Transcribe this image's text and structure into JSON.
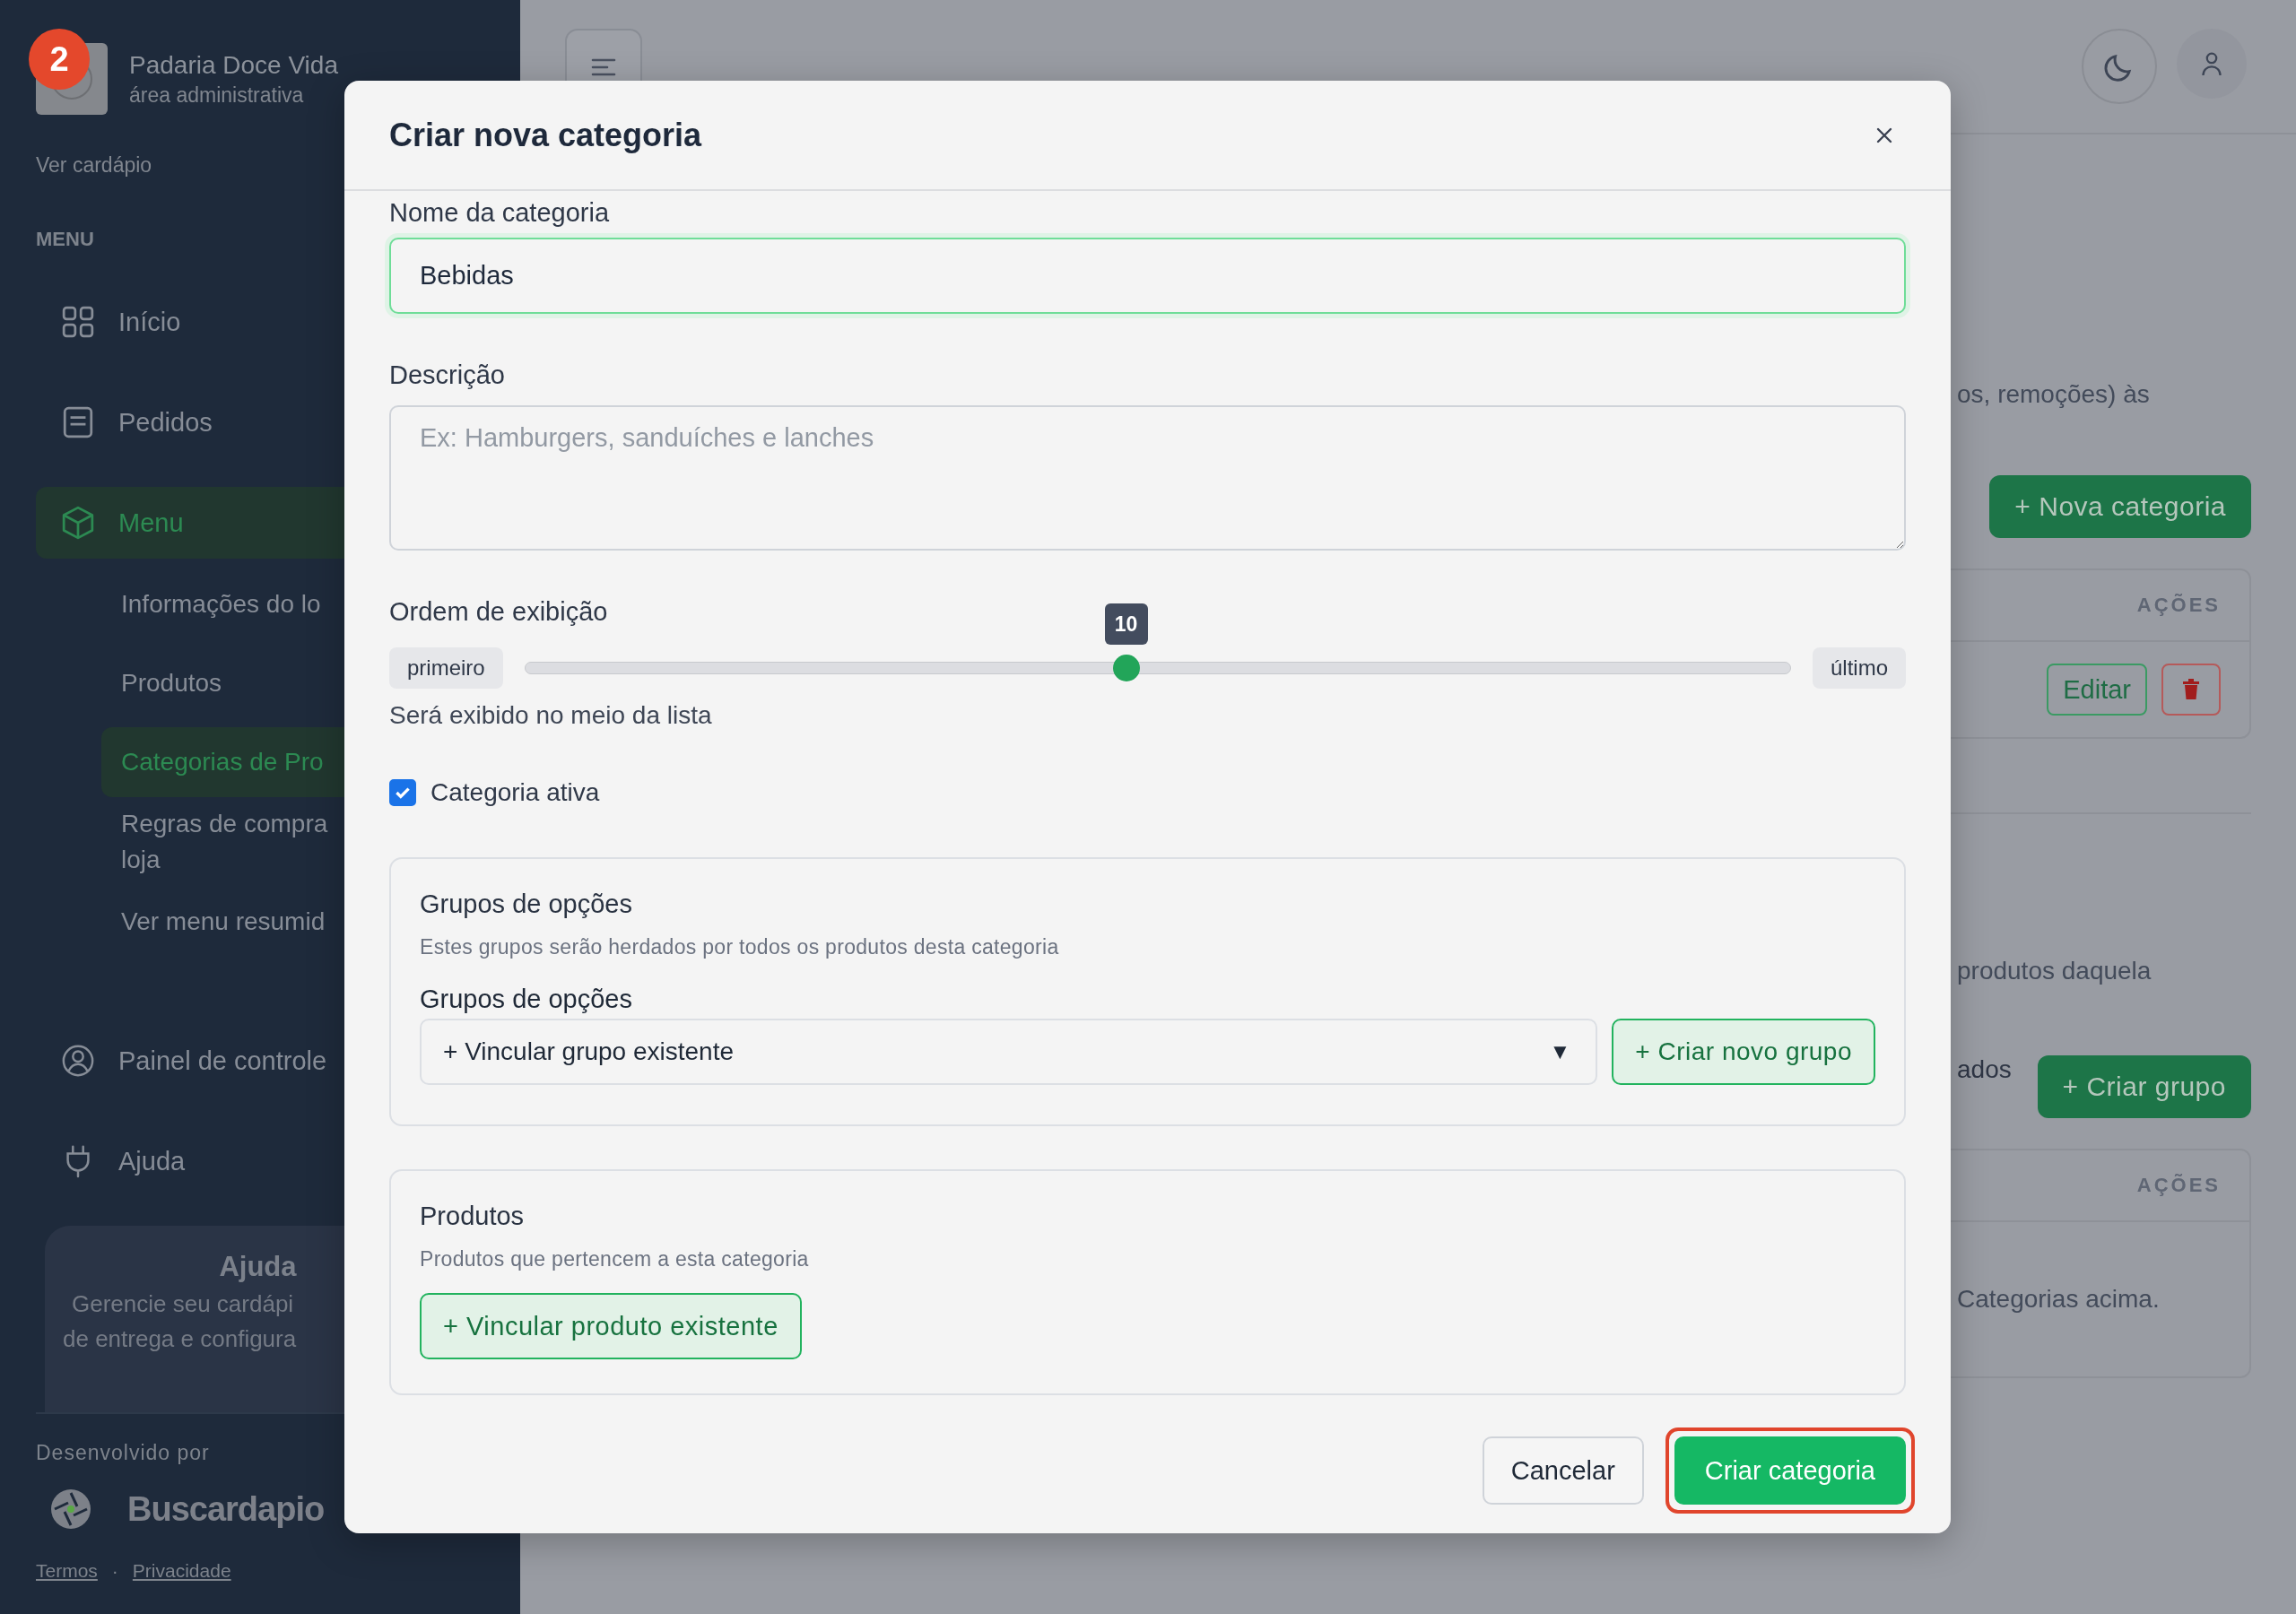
{
  "badge": {
    "text": "2"
  },
  "sidebar": {
    "store_name": "Padaria Doce Vida",
    "store_subtitle": "área administrativa",
    "view_menu_link": "Ver cardápio",
    "section_label": "MENU",
    "items": [
      {
        "label": "Início",
        "kind": "grid",
        "selected": false
      },
      {
        "label": "Pedidos",
        "kind": "list",
        "selected": false
      },
      {
        "label": "Menu",
        "kind": "cube",
        "selected": true,
        "children": [
          {
            "label": "Informações do lo",
            "selected": false
          },
          {
            "label": "Produtos",
            "selected": false
          },
          {
            "label": "Categorias de Pro",
            "selected": true
          },
          {
            "label": "Regras de compra loja",
            "selected": false
          },
          {
            "label": "Ver menu resumid",
            "selected": false
          }
        ]
      },
      {
        "label": "Painel de controle",
        "kind": "user",
        "selected": false
      },
      {
        "label": "Ajuda",
        "kind": "plug",
        "selected": false
      }
    ],
    "help_card": {
      "title": "Ajuda",
      "lines": [
        "Gerencie seu cardápi",
        "de entrega e configura"
      ]
    },
    "footer": {
      "developed_by": "Desenvolvido por",
      "brand": "Buscardapio",
      "links": [
        "Termos",
        "Privacidade"
      ],
      "separator": "·"
    }
  },
  "background": {
    "text_1": "os, remoções) às",
    "new_category_button": "+ Nova categoria",
    "table_1": {
      "actions_header": "AÇÕES",
      "edit_button": "Editar"
    },
    "text_2": "produtos daquela",
    "text_3": "ados",
    "create_group_button": "+ Criar grupo",
    "table_2": {
      "actions_header": "AÇÕES",
      "empty_text": "Categorias acima."
    }
  },
  "modal": {
    "title": "Criar nova categoria",
    "name_field": {
      "label": "Nome da categoria",
      "value": "Bebidas"
    },
    "description_field": {
      "label": "Descrição",
      "placeholder": "Ex: Hamburgers, sanduíches e lanches"
    },
    "order": {
      "label": "Ordem de exibição",
      "min_label": "primeiro",
      "max_label": "último",
      "value_label": "10",
      "level": 0.475,
      "hint": "Será exibido no meio da lista"
    },
    "active": {
      "label": "Categoria ativa",
      "checked": true
    },
    "option_groups": {
      "title": "Grupos de opções",
      "subtitle": "Estes grupos serão herdados por todos os produtos desta categoria",
      "field_label": "Grupos de opções",
      "select_value": "+ Vincular grupo existente",
      "select_caret": "▼",
      "create_button": "+ Criar novo grupo"
    },
    "products": {
      "title": "Produtos",
      "subtitle": "Produtos que pertencem a esta categoria",
      "link_button": "+ Vincular produto existente"
    },
    "buttons": [
      {
        "label": "Cancelar",
        "kind": "secondary",
        "highlighted": false
      },
      {
        "label": "Criar categoria",
        "kind": "primary",
        "highlighted": true
      }
    ]
  }
}
